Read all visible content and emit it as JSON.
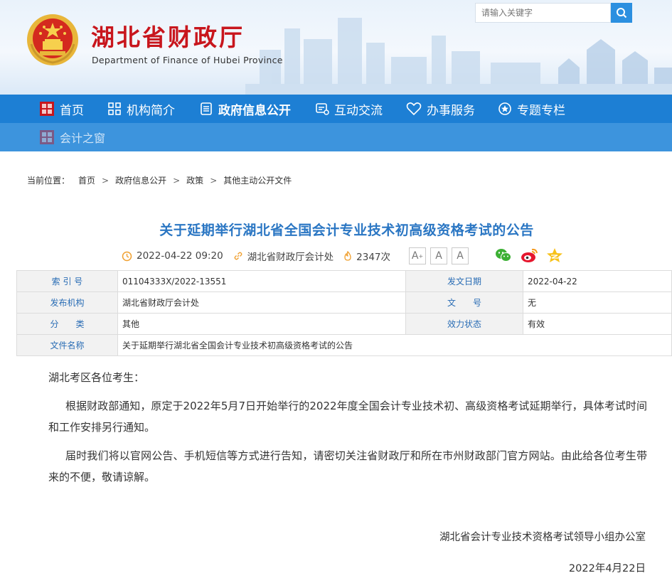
{
  "header": {
    "title": "湖北省财政厅",
    "subtitle": "Department of Finance of Hubei Province",
    "search_placeholder": "请输入关键字"
  },
  "nav": {
    "items": [
      {
        "label": "首页",
        "icon": "home-logo-icon"
      },
      {
        "label": "机构简介",
        "icon": "grid-icon"
      },
      {
        "label": "政府信息公开",
        "icon": "document-icon"
      },
      {
        "label": "互动交流",
        "icon": "chat-icon"
      },
      {
        "label": "办事服务",
        "icon": "heart-icon"
      },
      {
        "label": "专题专栏",
        "icon": "star-circle-icon"
      }
    ],
    "secondary": {
      "label": "会计之窗",
      "icon": "home-logo-icon"
    }
  },
  "breadcrumb": {
    "prefix": "当前位置：",
    "items": [
      "首页",
      "政府信息公开",
      "政策",
      "其他主动公开文件"
    ]
  },
  "article": {
    "title": "关于延期举行湖北省全国会计专业技术初高级资格考试的公告",
    "datetime": "2022-04-22 09:20",
    "source": "湖北省财政厅会计处",
    "views": "2347次",
    "font_sizes": [
      "A",
      "A",
      "A"
    ]
  },
  "info": {
    "index_label": "索 引 号",
    "index_value": "01104333X/2022-13551",
    "date_label": "发文日期",
    "date_value": "2022-04-22",
    "org_label": "发布机构",
    "org_value": "湖北省财政厅会计处",
    "doc_no_label": "文　　号",
    "doc_no_value": "无",
    "category_label": "分　　类",
    "category_value": "其他",
    "status_label": "效力状态",
    "status_value": "有效",
    "filename_label": "文件名称",
    "filename_value": "关于延期举行湖北省全国会计专业技术初高级资格考试的公告"
  },
  "body": {
    "greeting": "湖北考区各位考生：",
    "p1": "根据财政部通知，原定于2022年5月7日开始举行的2022年度全国会计专业技术初、高级资格考试延期举行，具体考试时间和工作安排另行通知。",
    "p2": "届时我们将以官网公告、手机短信等方式进行告知，请密切关注省财政厅和所在市州财政部门官方网站。由此给各位考生带来的不便，敬请谅解。",
    "signature": "湖北省会计专业技术资格考试领导小组办公室",
    "date": "2022年4月22日"
  },
  "colors": {
    "brand_red": "#c8161d",
    "nav_blue": "#1d7fd4",
    "title_blue": "#2a76c3"
  }
}
